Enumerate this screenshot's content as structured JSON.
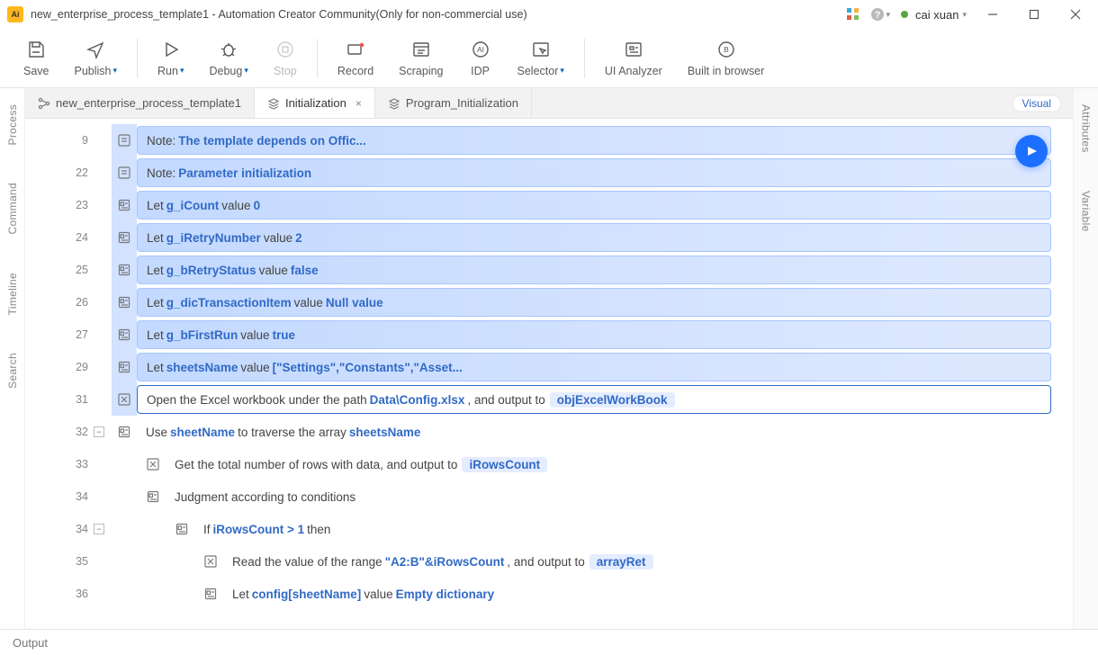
{
  "titlebar": {
    "title": "new_enterprise_process_template1 - Automation Creator Community(Only for non-commercial use)",
    "user": "cai xuan"
  },
  "toolbar": {
    "save": "Save",
    "publish": "Publish",
    "run": "Run",
    "debug": "Debug",
    "stop": "Stop",
    "record": "Record",
    "scraping": "Scraping",
    "idp": "IDP",
    "selector": "Selector",
    "analyzer": "UI Analyzer",
    "browser": "Built in browser"
  },
  "leftrail": {
    "process": "Process",
    "command": "Command",
    "timeline": "Timeline",
    "search": "Search"
  },
  "rightrail": {
    "attributes": "Attributes",
    "variable": "Variable"
  },
  "tabs": {
    "project": "new_enterprise_process_template1",
    "init": "Initialization",
    "prog": "Program_Initialization",
    "visual": "Visual"
  },
  "rows": [
    {
      "n": "9",
      "kind": "note",
      "hl": true,
      "indent": 0,
      "p": [
        "Note: "
      ],
      "kw": [
        "The template depends on Offic..."
      ]
    },
    {
      "n": "22",
      "kind": "note",
      "hl": true,
      "indent": 0,
      "p": [
        "Note: "
      ],
      "kw": [
        "Parameter initialization"
      ]
    },
    {
      "n": "23",
      "kind": "let",
      "hl": true,
      "indent": 0,
      "p": [
        "Let ",
        " value "
      ],
      "kw": [
        "g_iCount",
        "0"
      ]
    },
    {
      "n": "24",
      "kind": "let",
      "hl": true,
      "indent": 0,
      "p": [
        "Let ",
        " value "
      ],
      "kw": [
        "g_iRetryNumber",
        "2"
      ]
    },
    {
      "n": "25",
      "kind": "let",
      "hl": true,
      "indent": 0,
      "p": [
        "Let ",
        " value "
      ],
      "kw": [
        "g_bRetryStatus",
        "false"
      ]
    },
    {
      "n": "26",
      "kind": "let",
      "hl": true,
      "indent": 0,
      "p": [
        "Let ",
        " value "
      ],
      "kw": [
        "g_dicTransactionItem",
        "Null value"
      ]
    },
    {
      "n": "27",
      "kind": "let",
      "hl": true,
      "indent": 0,
      "p": [
        "Let ",
        " value "
      ],
      "kw": [
        "g_bFirstRun",
        "true"
      ]
    },
    {
      "n": "29",
      "kind": "let",
      "hl": true,
      "indent": 0,
      "p": [
        "Let ",
        " value "
      ],
      "kw": [
        "sheetsName",
        "[\"Settings\",\"Constants\",\"Asset..."
      ]
    },
    {
      "n": "31",
      "kind": "excel",
      "sel": true,
      "indent": 0,
      "p": [
        "Open the Excel workbook under the path ",
        " , and output to "
      ],
      "kw": [
        "Data\\Config.xlsx"
      ],
      "chip": "objExcelWorkBook"
    },
    {
      "n": "32",
      "kind": "loop",
      "indent": 0,
      "collapse": "-",
      "p": [
        "Use ",
        " to traverse the array "
      ],
      "kw": [
        "sheetName",
        "sheetsName"
      ]
    },
    {
      "n": "33",
      "kind": "excel",
      "indent": 1,
      "p": [
        "Get the total number of rows with data, and output to "
      ],
      "kw": [],
      "chip": "iRowsCount"
    },
    {
      "n": "34",
      "kind": "branch",
      "indent": 1,
      "p": [
        "Judgment according to conditions"
      ],
      "kw": []
    },
    {
      "n": "34",
      "kind": "branch",
      "indent": 2,
      "collapse": "-",
      "p": [
        "If ",
        " then"
      ],
      "kw": [
        "iRowsCount > 1"
      ]
    },
    {
      "n": "35",
      "kind": "excel",
      "indent": 3,
      "p": [
        "Read the value of the range ",
        " , and output to "
      ],
      "kw": [
        "\"A2:B\"&iRowsCount"
      ],
      "chip": "arrayRet"
    },
    {
      "n": "36",
      "kind": "let",
      "indent": 3,
      "p": [
        "Let ",
        " value "
      ],
      "kw": [
        "config[sheetName]",
        "Empty dictionary"
      ]
    }
  ],
  "output": "Output"
}
